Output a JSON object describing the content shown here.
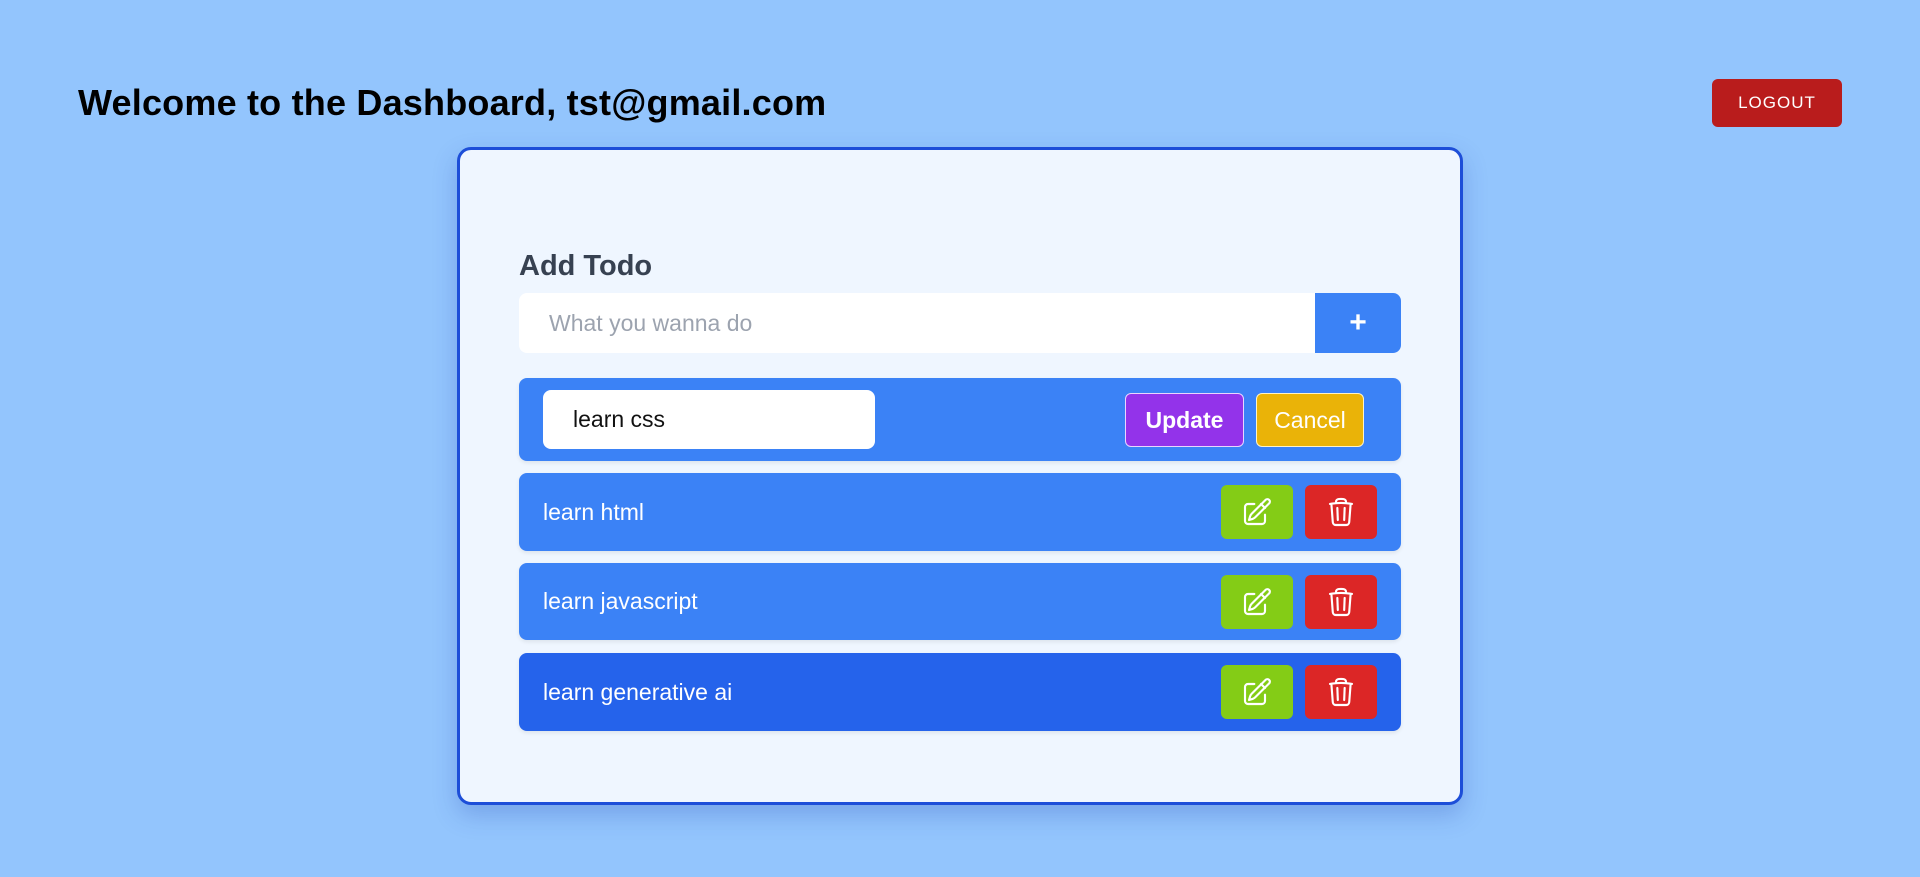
{
  "header": {
    "welcome_text": "Welcome to the Dashboard, tst@gmail.com",
    "logout_label": "LOGOUT"
  },
  "add_todo": {
    "title": "Add Todo",
    "input_placeholder": "What you wanna do",
    "input_value": "",
    "add_button_label": "+"
  },
  "editing_todo": {
    "input_value": "learn css",
    "update_label": "Update",
    "cancel_label": "Cancel"
  },
  "todos": [
    {
      "text": "learn html"
    },
    {
      "text": "learn javascript"
    },
    {
      "text": "learn generative ai"
    }
  ],
  "icons": {
    "edit": "pencil-square-icon",
    "delete": "trash-icon"
  },
  "colors": {
    "background": "#93c5fd",
    "card_border": "#1d4ed8",
    "row": "#3b82f6",
    "row_hover": "#2563eb",
    "logout": "#b91c1c",
    "update": "#9333ea",
    "cancel": "#eab308",
    "edit": "#84cc16",
    "delete": "#dc2626"
  }
}
